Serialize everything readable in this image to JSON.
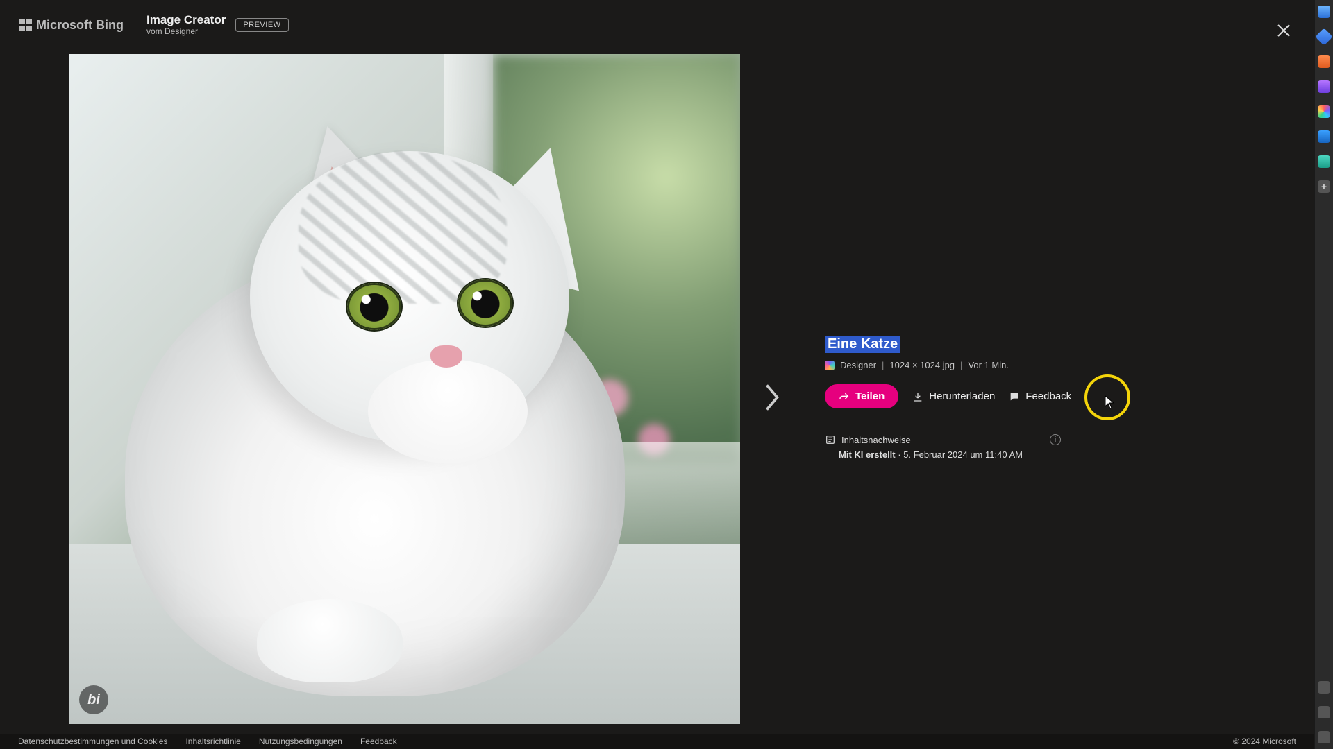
{
  "header": {
    "brand": "Microsoft Bing",
    "product_title": "Image Creator",
    "product_subtitle": "vom Designer",
    "preview_badge": "PREVIEW"
  },
  "image": {
    "bi_watermark": "bi"
  },
  "details": {
    "prompt": "Eine Katze",
    "source_label": "Designer",
    "dimensions": "1024 × 1024 jpg",
    "age": "Vor 1 Min.",
    "separator": "|",
    "actions": {
      "share": "Teilen",
      "download": "Herunterladen",
      "feedback": "Feedback"
    },
    "provenance": {
      "heading": "Inhaltsnachweise",
      "ai_label": "Mit KI erstellt",
      "timestamp": "5. Februar 2024 um 11:40 AM",
      "dot": " · "
    }
  },
  "footer": {
    "links": {
      "privacy": "Datenschutzbestimmungen und Cookies",
      "content_policy": "Inhaltsrichtlinie",
      "terms": "Nutzungsbedingungen",
      "feedback": "Feedback"
    },
    "copyright": "© 2024 Microsoft"
  }
}
